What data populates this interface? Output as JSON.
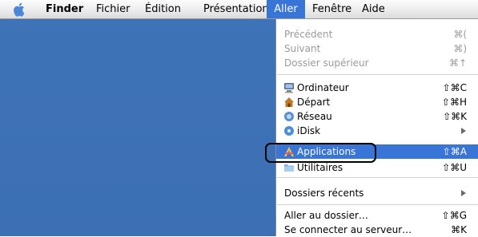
{
  "menubar": {
    "apple_icon": "",
    "items": [
      "Finder",
      "Fichier",
      "Édition",
      "Présentation",
      "Aller",
      "Fenêtre",
      "Aide"
    ]
  },
  "aller_menu": {
    "group1": [
      {
        "label": "Précédent",
        "shortcut": "⌘(",
        "enabled": false
      },
      {
        "label": "Suivant",
        "shortcut": "⌘)",
        "enabled": false
      },
      {
        "label": "Dossier supérieur",
        "shortcut": "⌘↑",
        "enabled": false
      }
    ],
    "group2": [
      {
        "label": "Ordinateur",
        "shortcut": "⇧⌘C",
        "icon": "computer-icon"
      },
      {
        "label": "Départ",
        "shortcut": "⇧⌘H",
        "icon": "home-icon"
      },
      {
        "label": "Réseau",
        "shortcut": "⇧⌘K",
        "icon": "network-icon"
      },
      {
        "label": "iDisk",
        "shortcut": "",
        "icon": "idisk-icon",
        "submenu": true
      },
      {
        "label": "Applications",
        "shortcut": "⇧⌘A",
        "icon": "applications-icon",
        "selected": true
      },
      {
        "label": "Utilitaires",
        "shortcut": "⇧⌘U",
        "icon": "utilities-folder-icon"
      }
    ],
    "group3": [
      {
        "label": "Dossiers récents",
        "submenu": true
      }
    ],
    "group4": [
      {
        "label": "Aller au dossier…",
        "shortcut": "⇧⌘G"
      },
      {
        "label": "Se connecter au serveur…",
        "shortcut": "⌘K"
      }
    ]
  },
  "colors": {
    "desktop": "#3c6fb3",
    "highlight": "#3875d7"
  }
}
